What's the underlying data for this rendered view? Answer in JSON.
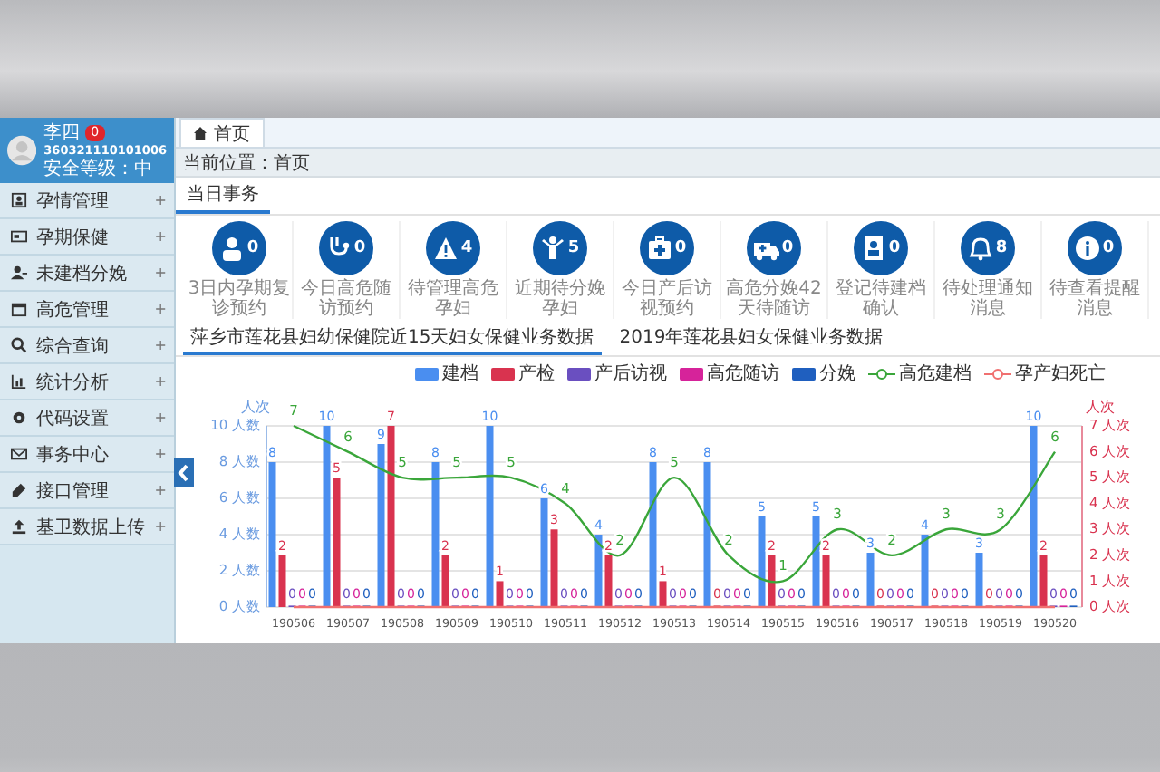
{
  "user": {
    "name": "李四",
    "badge": "0",
    "id": "360321110101006",
    "level": "安全等级：中"
  },
  "sidebar": {
    "items": [
      {
        "label": "孕情管理",
        "expand": "+"
      },
      {
        "label": "孕期保健",
        "expand": "+"
      },
      {
        "label": "未建档分娩",
        "expand": "+"
      },
      {
        "label": "高危管理",
        "expand": "+"
      },
      {
        "label": "综合查询",
        "expand": "+"
      },
      {
        "label": "统计分析",
        "expand": "+"
      },
      {
        "label": "代码设置",
        "expand": "+"
      },
      {
        "label": "事务中心",
        "expand": "+"
      },
      {
        "label": "接口管理",
        "expand": "+"
      },
      {
        "label": "基卫数据上传",
        "expand": "+"
      }
    ]
  },
  "tabs": [
    {
      "label": "首页",
      "selected": true
    }
  ],
  "breadcrumb": "当前位置：首页",
  "section_tab": {
    "label": "当日事务",
    "selected": true
  },
  "tasks": [
    {
      "count": "0",
      "label": "3日内孕期复诊预约"
    },
    {
      "count": "0",
      "label": "今日高危随访预约"
    },
    {
      "count": "4",
      "label": "待管理高危孕妇"
    },
    {
      "count": "5",
      "label": "近期待分娩孕妇"
    },
    {
      "count": "0",
      "label": "今日产后访视预约"
    },
    {
      "count": "0",
      "label": "高危分娩42天待随访"
    },
    {
      "count": "0",
      "label": "登记待建档确认"
    },
    {
      "count": "8",
      "label": "待处理通知消息"
    },
    {
      "count": "0",
      "label": "待查看提醒消息"
    }
  ],
  "chart_tabs": [
    {
      "label": "萍乡市莲花县妇幼保健院近15天妇女保健业务数据",
      "selected": true
    },
    {
      "label": "2019年莲花县妇女保健业务数据",
      "selected": false
    }
  ],
  "chart": {
    "chart_data": {
      "type": "bar",
      "ylabel": "人次",
      "y2label": "人次",
      "ylim": [
        0,
        10
      ],
      "y2lim": [
        0,
        7
      ],
      "yticks": [
        {
          "value": 0,
          "label": "0 人数"
        },
        {
          "value": 2,
          "label": "2 人数"
        },
        {
          "value": 4,
          "label": "4 人数"
        },
        {
          "value": 6,
          "label": "6 人数"
        },
        {
          "value": 8,
          "label": "8 人数"
        },
        {
          "value": 10,
          "label": "10 人数"
        }
      ],
      "y2ticks": [
        {
          "value": 0,
          "label": "0 人次"
        },
        {
          "value": 1,
          "label": "1 人次"
        },
        {
          "value": 2,
          "label": "2 人次"
        },
        {
          "value": 3,
          "label": "3 人次"
        },
        {
          "value": 4,
          "label": "4 人次"
        },
        {
          "value": 5,
          "label": "5 人次"
        },
        {
          "value": 6,
          "label": "6 人次"
        },
        {
          "value": 7,
          "label": "7 人次"
        }
      ],
      "data_labels": true,
      "grid": true,
      "legend": "top-right",
      "categories": [
        "190506",
        "190507",
        "190508",
        "190509",
        "190510",
        "190511",
        "190512",
        "190513",
        "190514",
        "190515",
        "190516",
        "190517",
        "190518",
        "190519",
        "190520"
      ],
      "series": [
        {
          "name": "建档",
          "color": "#4a8ef0",
          "values": [
            8,
            10,
            9,
            8,
            10,
            6,
            4,
            8,
            8,
            5,
            5,
            3,
            4,
            3,
            10
          ]
        },
        {
          "name": "产检",
          "axis": "y2",
          "color": "#d9334f",
          "values": [
            2,
            5,
            7,
            2,
            1,
            3,
            2,
            1,
            0,
            2,
            2,
            0,
            0,
            0,
            2
          ]
        },
        {
          "name": "产后访视",
          "axis": "y2",
          "color": "#6a4fc0",
          "values": [
            0,
            0,
            0,
            0,
            0,
            0,
            0,
            0,
            0,
            0,
            0,
            0,
            0,
            0,
            0
          ]
        },
        {
          "name": "高危随访",
          "axis": "y2",
          "color": "#d6239a",
          "values": [
            0,
            0,
            0,
            0,
            0,
            0,
            0,
            0,
            0,
            0,
            0,
            0,
            0,
            0,
            0
          ]
        },
        {
          "name": "分娩",
          "axis": "y2",
          "color": "#1f5fbf",
          "values": [
            0,
            0,
            0,
            0,
            0,
            0,
            0,
            0,
            0,
            0,
            0,
            0,
            0,
            0,
            0
          ]
        },
        {
          "name": "高危建档",
          "type": "line",
          "axis": "y2",
          "color": "#3aa63a",
          "values": [
            7,
            6,
            5,
            5,
            5,
            4,
            2,
            5,
            2,
            1,
            3,
            2,
            3,
            3,
            6
          ]
        },
        {
          "name": "孕产妇死亡",
          "type": "line",
          "axis": "y2",
          "color": "#f07070",
          "values": [
            0,
            0,
            0,
            0,
            0,
            0,
            0,
            0,
            0,
            0,
            0,
            0,
            0,
            0,
            0
          ],
          "value_labels": [
            null,
            null,
            null,
            null,
            null,
            null,
            null,
            null,
            null,
            null,
            null,
            null,
            null,
            null,
            null
          ]
        }
      ]
    }
  }
}
